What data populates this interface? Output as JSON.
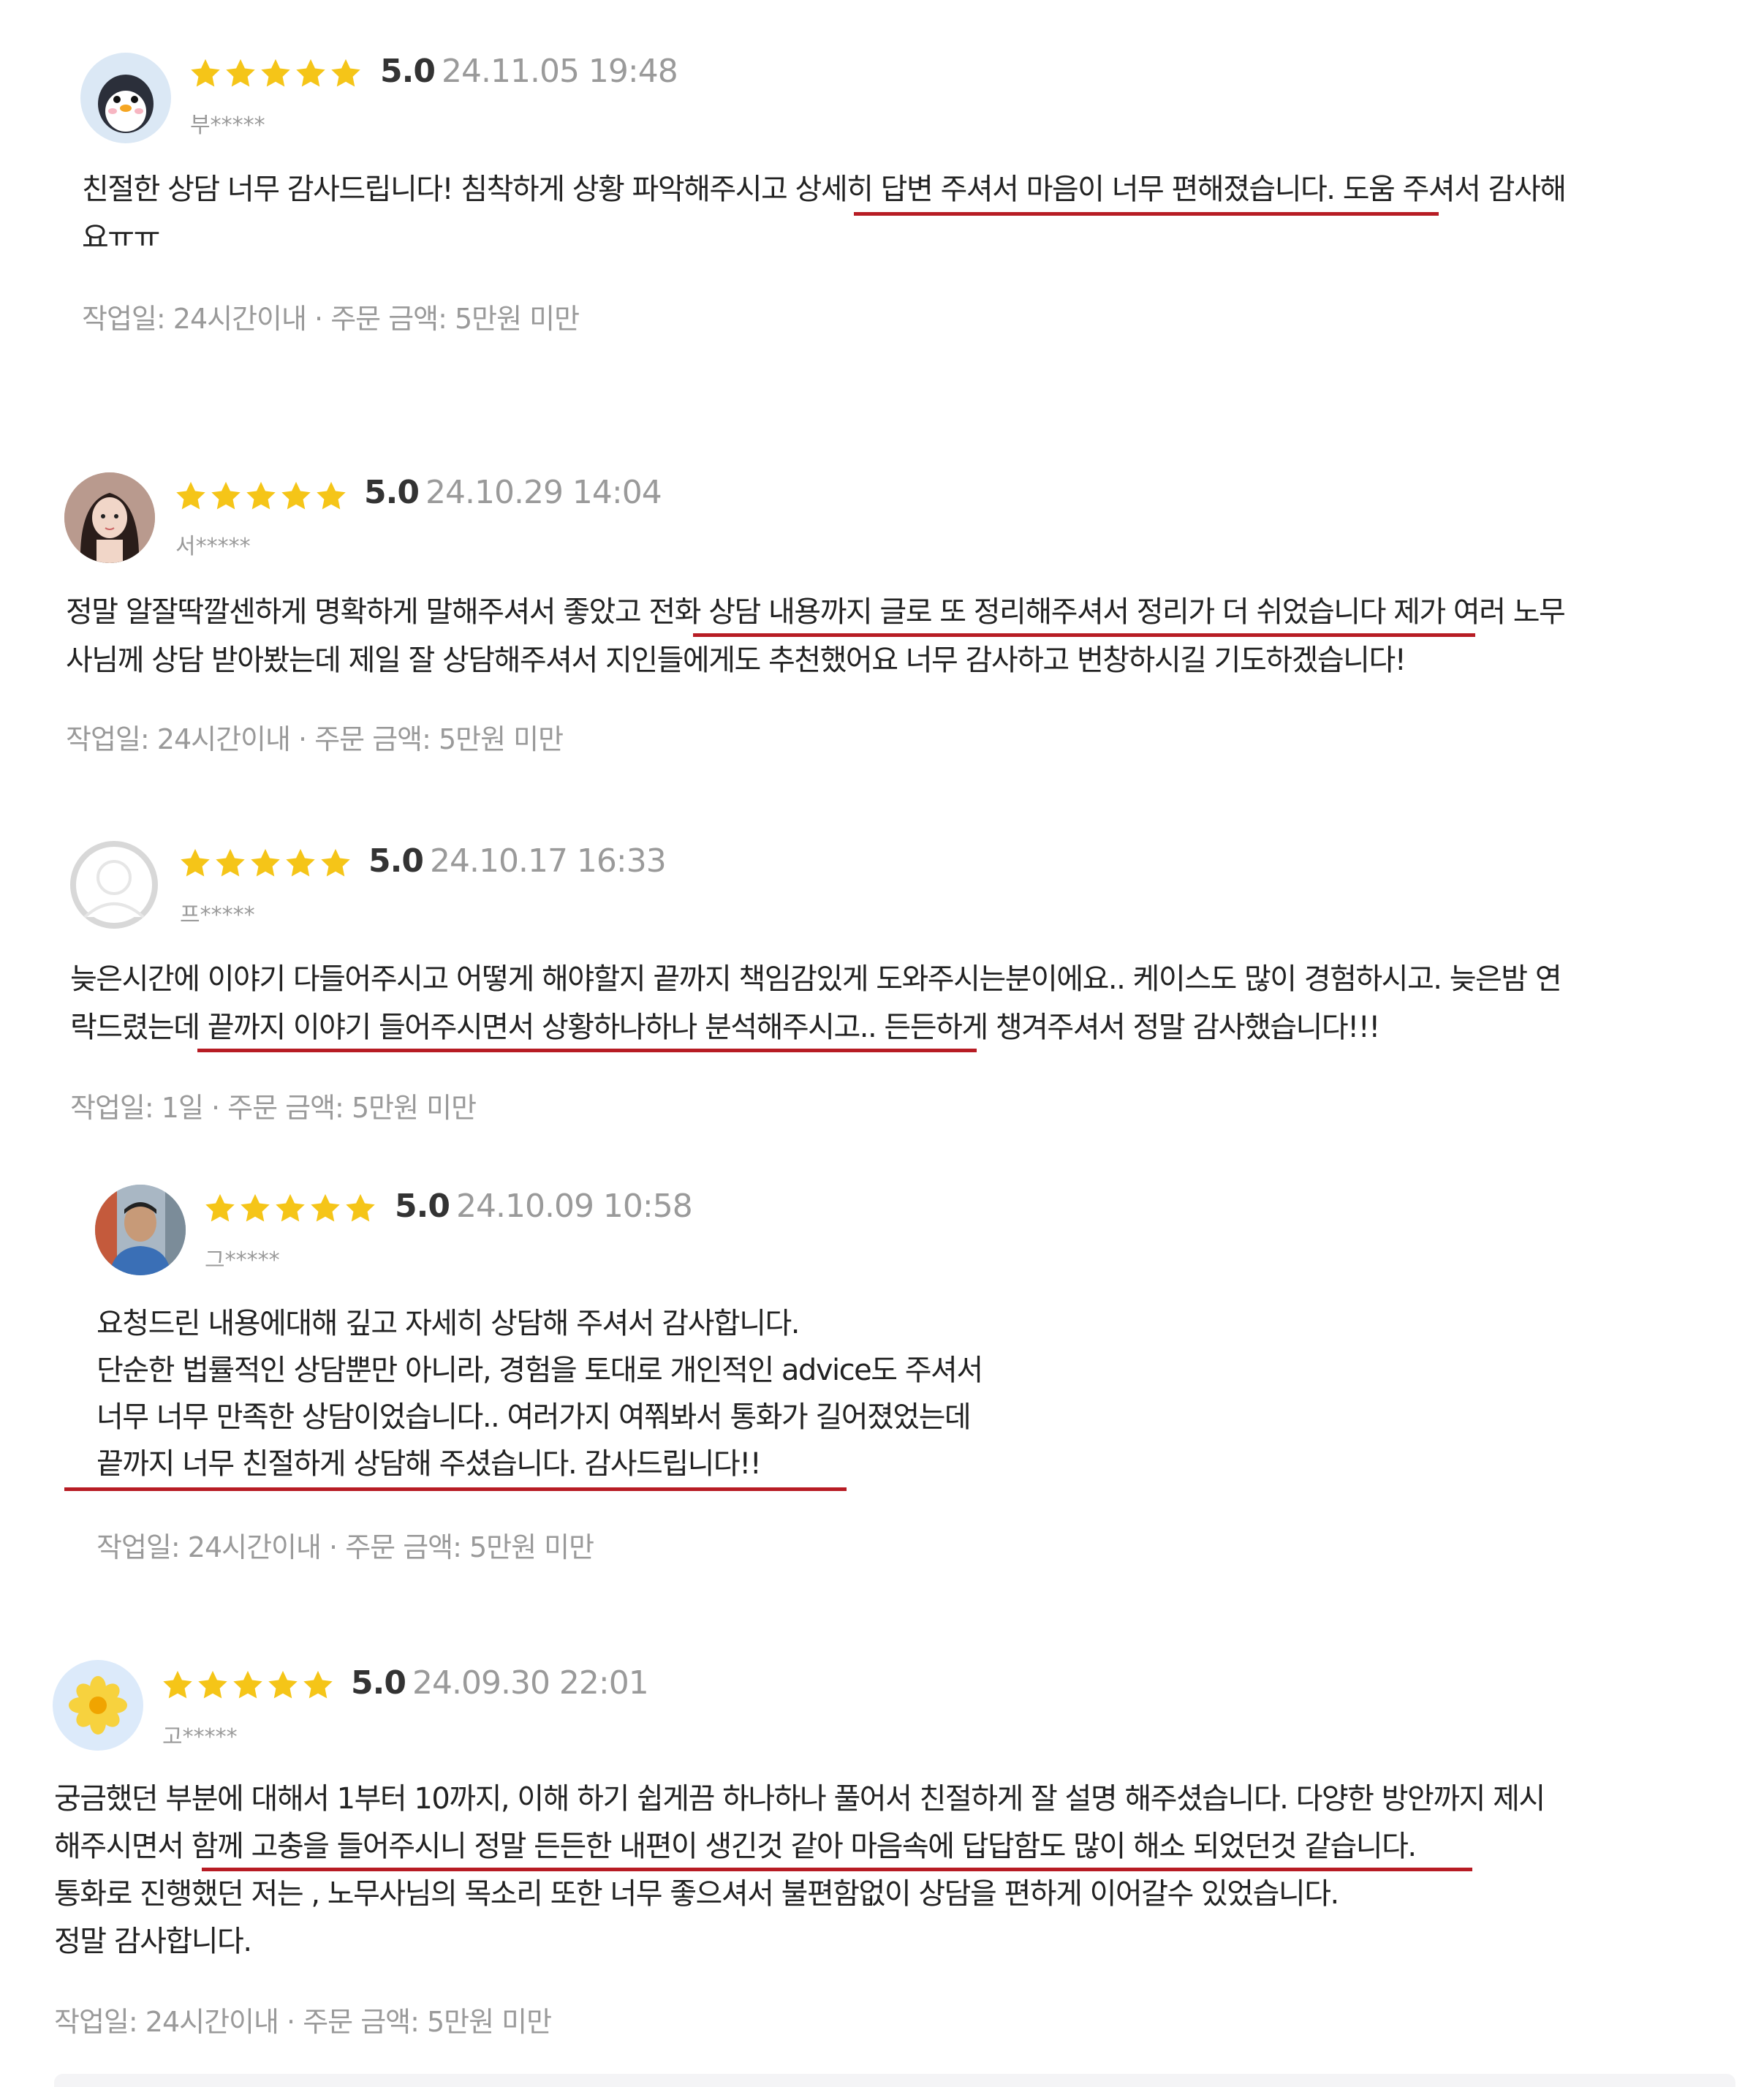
{
  "colors": {
    "star": "#f5c518",
    "underline": "#b71c24",
    "muted": "#9a9a9a"
  },
  "reviews": [
    {
      "avatar": "penguin-avatar",
      "score": "5.0",
      "date": "24.11.05 19:48",
      "user": "부*****",
      "lines": [
        "친절한 상담 너무 감사드립니다! 침착하게 상황 파악해주시고 상세히 답변 주셔서 마음이 너무 편해졌습니다. 도움 주셔서 감사해",
        "요ㅠㅠ"
      ],
      "meta": "작업일: 24시간이내 · 주문 금액: 5만원 미만"
    },
    {
      "avatar": "woman-photo-avatar",
      "score": "5.0",
      "date": "24.10.29 14:04",
      "user": "서*****",
      "lines": [
        "정말 알잘딱깔센하게 명확하게 말해주셔서 좋았고 전화 상담 내용까지 글로 또 정리해주셔서 정리가 더 쉬었습니다 제가 여러 노무",
        "사님께 상담 받아봤는데 제일 잘 상담해주셔서 지인들에게도 추천했어요 너무 감사하고 번창하시길 기도하겠습니다!"
      ],
      "meta": "작업일: 24시간이내 · 주문 금액: 5만원 미만"
    },
    {
      "avatar": "default-user-avatar",
      "score": "5.0",
      "date": "24.10.17 16:33",
      "user": "프*****",
      "lines": [
        "늦은시간에 이야기 다들어주시고 어떻게 해야할지 끝까지 책임감있게 도와주시는분이에요.. 케이스도 많이 경험하시고. 늦은밤 연",
        "락드렸는데 끝까지 이야기 들어주시면서 상황하나하나 분석해주시고.. 든든하게 챙겨주셔서 정말 감사했습니다!!!"
      ],
      "meta": "작업일: 1일 · 주문 금액: 5만원 미만"
    },
    {
      "avatar": "man-photo-avatar",
      "score": "5.0",
      "date": "24.10.09 10:58",
      "user": "그*****",
      "lines": [
        "요청드린 내용에대해 깊고 자세히 상담해 주셔서 감사합니다.",
        "단순한 법률적인 상담뿐만 아니라, 경험을 토대로 개인적인 advice도 주셔서",
        "너무 너무 만족한 상담이었습니다.. 여러가지 여쭤봐서 통화가 길어졌었는데",
        "끝까지 너무 친절하게 상담해 주셨습니다. 감사드립니다!!"
      ],
      "meta": "작업일: 24시간이내 · 주문 금액: 5만원 미만"
    },
    {
      "avatar": "flower-avatar",
      "score": "5.0",
      "date": "24.09.30 22:01",
      "user": "고*****",
      "lines": [
        "궁금했던 부분에 대해서 1부터 10까지, 이해 하기 쉽게끔 하나하나 풀어서 친절하게 잘 설명 해주셨습니다. 다양한 방안까지 제시",
        "해주시면서 함께 고충을 들어주시니 정말 든든한 내편이 생긴것 같아 마음속에 답답함도 많이 해소 되었던것 같습니다.",
        "통화로 진행했던 저는 , 노무사님의 목소리 또한 너무 좋으셔서 불편함없이 상담을 편하게 이어갈수 있었습니다.",
        "정말 감사합니다."
      ],
      "meta": "작업일: 24시간이내 · 주문 금액: 5만원 미만"
    }
  ]
}
